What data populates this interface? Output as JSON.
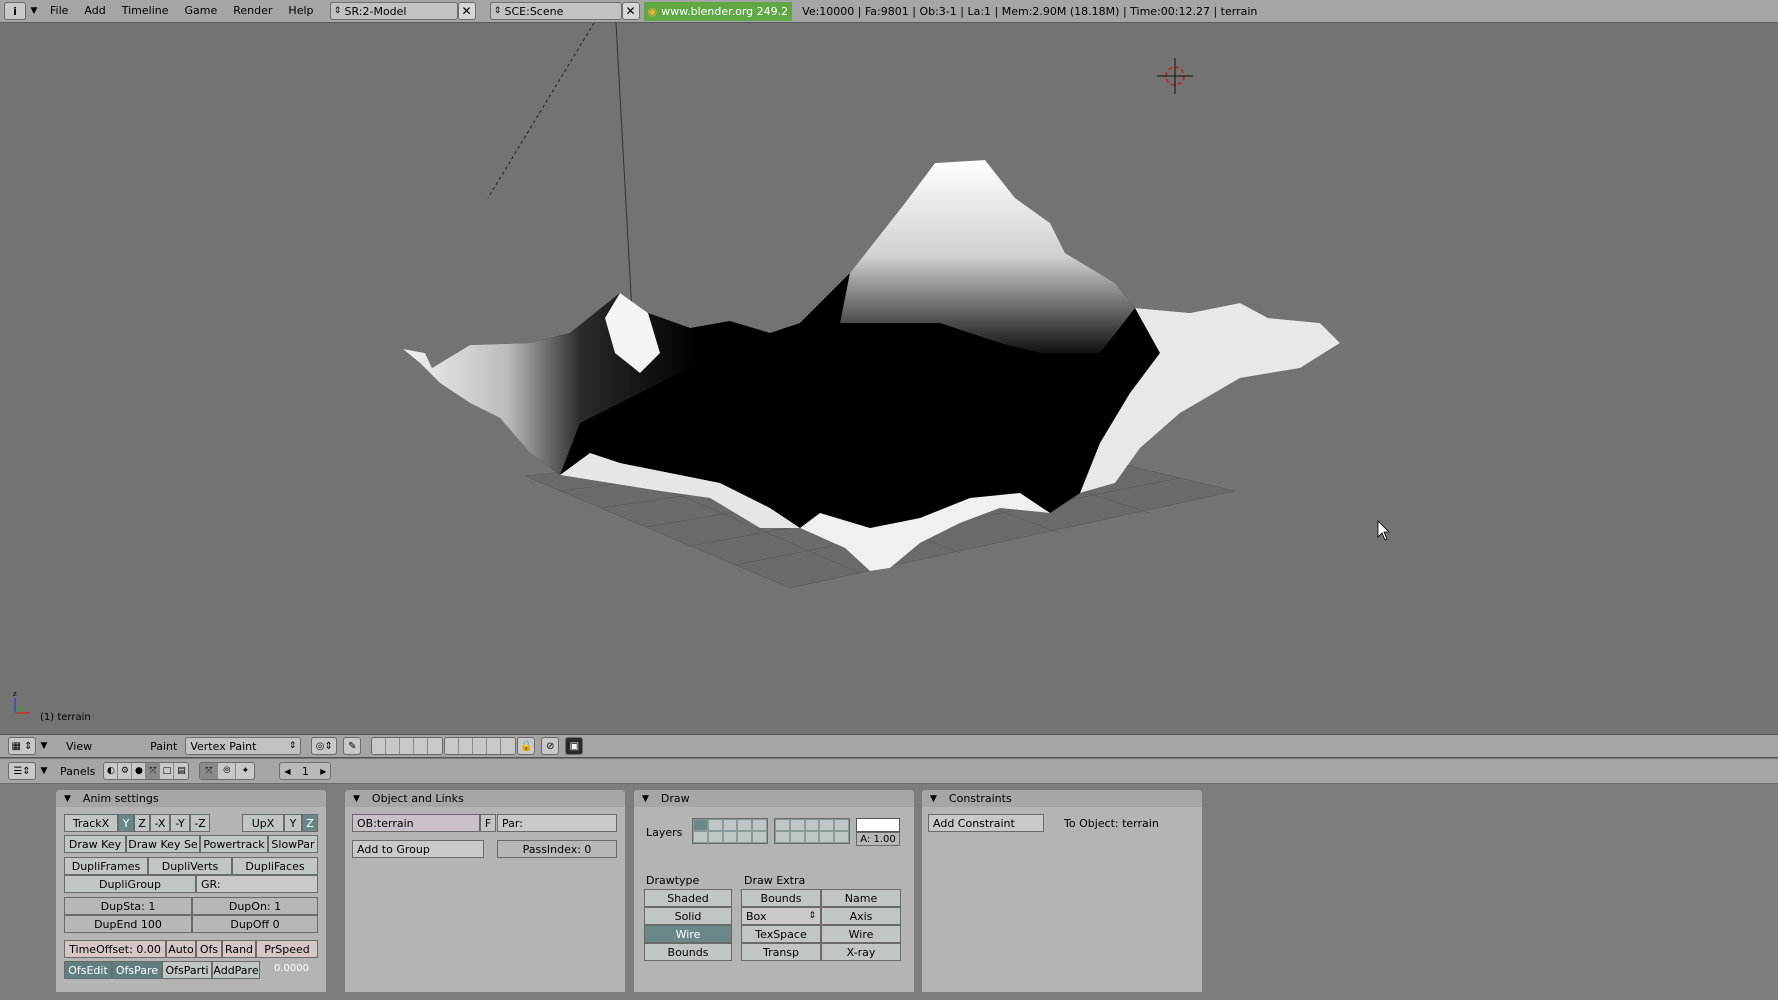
{
  "topbar": {
    "menus": [
      "File",
      "Add",
      "Timeline",
      "Game",
      "Render",
      "Help"
    ],
    "screen_field": "SR:2-Model",
    "scene_field": "SCE:Scene",
    "version": "www.blender.org 249.2",
    "stats": "Ve:10000 | Fa:9801 | Ob:3-1 | La:1 | Mem:2.90M (18.18M) | Time:00:12.27 | terrain"
  },
  "viewport": {
    "object_info": "(1) terrain"
  },
  "view_header": {
    "view_menu": "View",
    "paint_label": "Paint",
    "mode": "Vertex Paint"
  },
  "buttons_header": {
    "panels_label": "Panels",
    "frame": "1"
  },
  "anim_settings": {
    "title": "Anim settings",
    "trackx": "TrackX",
    "track_axes": [
      "Y",
      "Z",
      "-X",
      "-Y",
      "-Z"
    ],
    "upx": "UpX",
    "up_axes": [
      "Y",
      "Z"
    ],
    "draw_key": "Draw Key",
    "draw_key_sel": "Draw Key Se",
    "powertrack": "Powertrack",
    "slowpar": "SlowPar",
    "dupliframes": "DupliFrames",
    "dupliverts": "DupliVerts",
    "duplifaces": "DupliFaces",
    "dupligroup": "DupliGroup",
    "gr": "GR:",
    "dupsta": "DupSta: 1",
    "dupon": "DupOn: 1",
    "dupend": "DupEnd 100",
    "dupoff": "DupOff 0",
    "timeoffset": "TimeOffset: 0.00",
    "auto": "Auto",
    "ofs": "Ofs",
    "rand": "Rand",
    "prspeed": "PrSpeed",
    "ofsedit": "OfsEdit",
    "ofspare": "OfsPare",
    "ofsparti": "OfsParti",
    "addpare": "AddPare",
    "prspeed_value": "0.0000"
  },
  "object_links": {
    "title": "Object and Links",
    "ob_field": "OB:terrain",
    "f_button": "F",
    "par_field": "Par:",
    "add_to_group": "Add to Group",
    "passindex": "PassIndex: 0"
  },
  "draw": {
    "title": "Draw",
    "layers_label": "Layers",
    "alpha": "A: 1.00",
    "drawtype_label": "Drawtype",
    "drawtypes": [
      "Shaded",
      "Solid",
      "Wire",
      "Bounds"
    ],
    "drawtype_selected": "Wire",
    "draw_extra_label": "Draw Extra",
    "bounds": "Bounds",
    "box": "Box",
    "texspace": "TexSpace",
    "transp": "Transp",
    "name": "Name",
    "axis": "Axis",
    "wire": "Wire",
    "xray": "X-ray"
  },
  "constraints": {
    "title": "Constraints",
    "add_constraint": "Add Constraint",
    "to_object": "To Object: terrain"
  }
}
